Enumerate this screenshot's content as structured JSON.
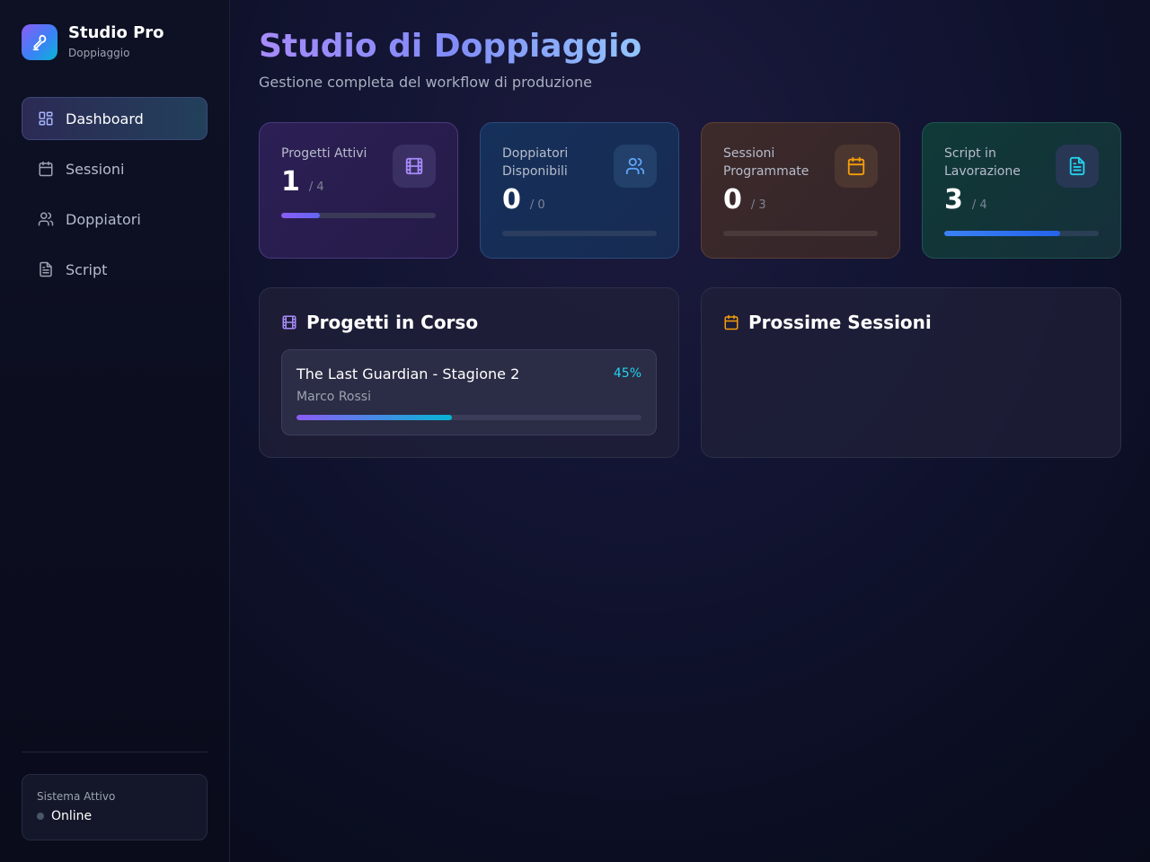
{
  "sidebar": {
    "brand": {
      "title": "Studio Pro",
      "subtitle": "Doppiaggio"
    },
    "nav": [
      {
        "label": "Dashboard",
        "icon": "grid-icon",
        "active": true
      },
      {
        "label": "Sessioni",
        "icon": "calendar-icon",
        "active": false
      },
      {
        "label": "Doppiatori",
        "icon": "users-icon",
        "active": false
      },
      {
        "label": "Script",
        "icon": "document-icon",
        "active": false
      }
    ],
    "status": {
      "label": "Sistema Attivo",
      "value": "Online"
    }
  },
  "header": {
    "title": "Studio di Doppiaggio",
    "subtitle": "Gestione completa del workflow di produzione"
  },
  "stats": [
    {
      "label": "Progetti Attivi",
      "value": "1",
      "total": "/ 4",
      "fill_fraction": 0.25,
      "icon": "film-icon",
      "color": "#a78bfa"
    },
    {
      "label": "Doppiatori Disponibili",
      "value": "0",
      "total": "/ 0",
      "fill_fraction": 0,
      "icon": "users-icon",
      "color": "#60a5fa"
    },
    {
      "label": "Sessioni Programmate",
      "value": "0",
      "total": "/ 3",
      "fill_fraction": 0,
      "icon": "calendar-icon",
      "color": "#f59e0b"
    },
    {
      "label": "Script in Lavorazione",
      "value": "3",
      "total": "/ 4",
      "fill_fraction": 0.75,
      "icon": "document-icon",
      "color": "#22d3ee"
    }
  ],
  "panels": {
    "projects": {
      "title": "Progetti in Corso",
      "items": [
        {
          "name": "The Last Guardian - Stagione 2",
          "owner": "Marco Rossi",
          "progress_label": "45%",
          "progress": 0.45
        }
      ]
    },
    "sessions": {
      "title": "Prossime Sessioni",
      "items": []
    }
  },
  "colors": {
    "accent": "#8b5cf6",
    "cyan": "#22d3ee",
    "amber": "#f59e0b",
    "background": "#0b0d1f"
  }
}
